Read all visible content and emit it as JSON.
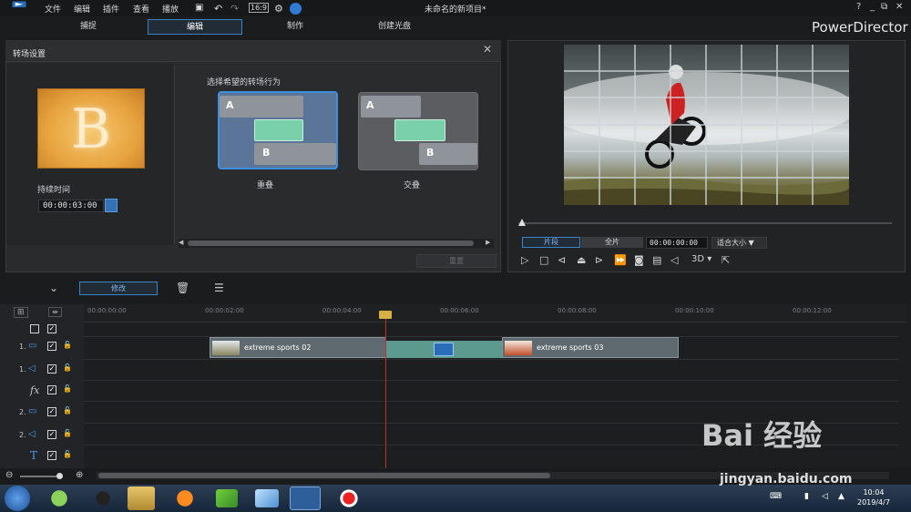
{
  "app": {
    "menus": [
      "文件",
      "编辑",
      "插件",
      "查看",
      "播放"
    ],
    "document_title": "未命名的新项目*",
    "brand": "PowerDirector",
    "help": "?",
    "tabs": [
      "捕捉",
      "编辑",
      "制作",
      "创建光盘"
    ],
    "active_tab": "编辑"
  },
  "transition_panel": {
    "title": "转场设置",
    "thumbnail_letter": "B",
    "duration_label": "持续时间",
    "duration_value": "00:00:03:00",
    "choose_label": "选择希望的转场行为",
    "options": [
      {
        "label": "重叠",
        "selected": true,
        "a": "A",
        "b": "B"
      },
      {
        "label": "交叠",
        "selected": false,
        "a": "A",
        "b": "B"
      }
    ],
    "reset_label": "重置"
  },
  "preview": {
    "clip_mode": "片段",
    "full_mode": "全片",
    "timecode": "00:00:00:00",
    "fit_label": "适合大小",
    "three_d": "3D"
  },
  "toolbar": {
    "modify_label": "修改"
  },
  "timeline": {
    "ruler": [
      "00:00:00:00",
      "00:00:02:00",
      "00:00:04:00",
      "00:00:06:00",
      "00:00:08:00",
      "00:00:10:00",
      "00:00:12:00"
    ],
    "tracks": [
      {
        "num": "1.",
        "kind": "video"
      },
      {
        "num": "1.",
        "kind": "audio"
      },
      {
        "num": "",
        "kind": "fx",
        "label": "fx"
      },
      {
        "num": "2.",
        "kind": "video"
      },
      {
        "num": "2.",
        "kind": "audio"
      },
      {
        "num": "",
        "kind": "title",
        "label": "T"
      }
    ],
    "clips": [
      "extreme sports 02",
      "extreme sports 03"
    ]
  },
  "taskbar": {
    "time": "10:04",
    "date": "2019/4/7"
  },
  "watermark": {
    "brand": "Bai 经验",
    "url": "jingyan.baidu.com"
  },
  "colors": {
    "accent": "#3b83c6",
    "transition": "#5d9a8e",
    "playhead": "#c03030"
  }
}
